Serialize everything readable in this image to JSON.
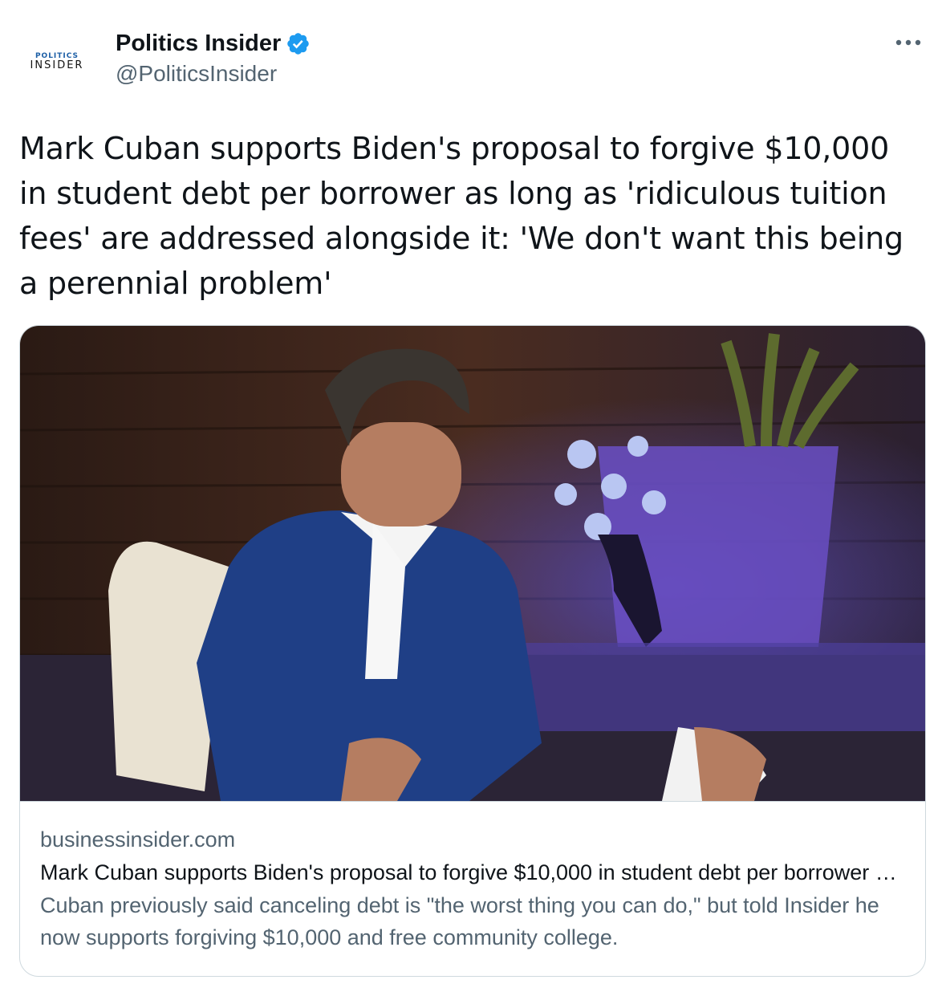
{
  "tweet": {
    "author": {
      "avatar_text_top": "POLITICS",
      "avatar_text_bottom": "INSIDER",
      "display_name": "Politics Insider",
      "handle": "@PoliticsInsider",
      "verified": true
    },
    "more_icon": "ellipsis-icon",
    "text": "Mark Cuban supports Biden's proposal to forgive $10,000 in student debt per borrower as long as 'ridiculous tuition fees' are addressed alongside it: 'We don't want this being a perennial problem'"
  },
  "link_card": {
    "image_subject": "man in blue blazer seated in white chair",
    "domain": "businessinsider.com",
    "title": "Mark Cuban supports Biden's proposal to forgive $10,000 in student debt per borrower as long as 'ridiculous tuition fees' are addressed alongside it",
    "description": "Cuban previously said canceling debt is \"the worst thing you can do,\" but told Insider he now supports forgiving $10,000 and free community college."
  },
  "colors": {
    "text_primary": "#0f1419",
    "text_secondary": "#536471",
    "verified_blue": "#1d9bf0",
    "border": "#cfd9de"
  }
}
